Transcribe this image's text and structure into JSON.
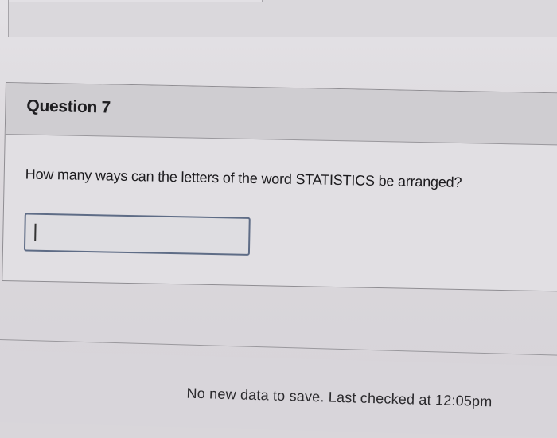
{
  "question": {
    "title": "Question 7",
    "text": "How many ways can the letters of the word STATISTICS be arranged?",
    "answer_value": "",
    "answer_placeholder": ""
  },
  "footer": {
    "status": "No new data to save. Last checked at 12:05pm"
  }
}
